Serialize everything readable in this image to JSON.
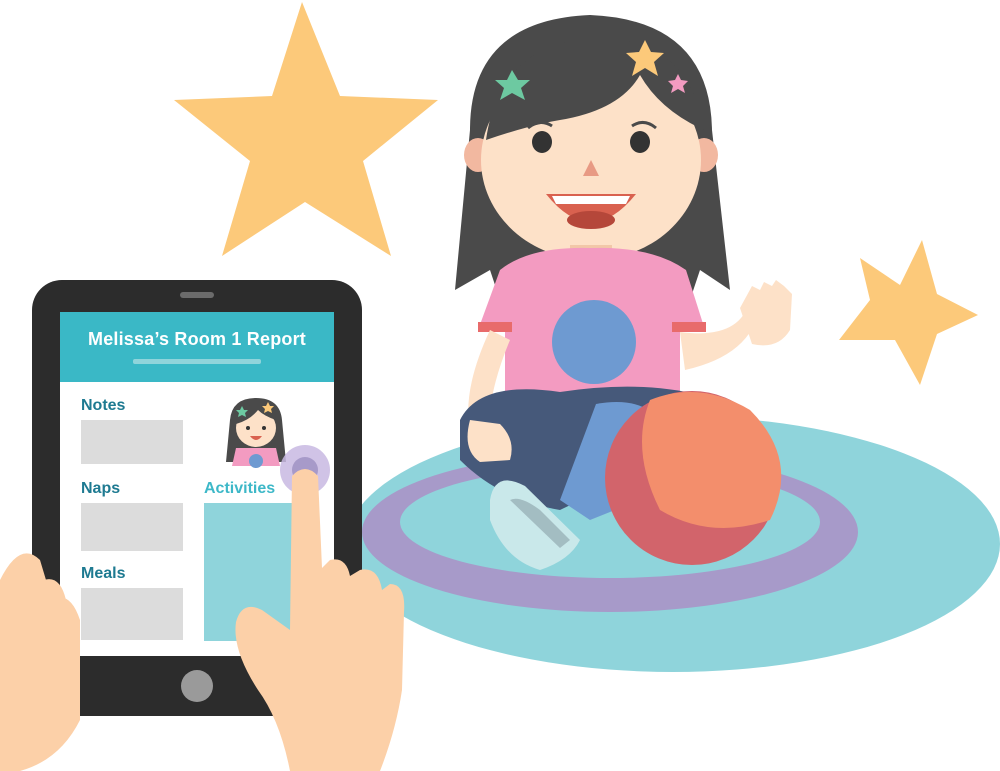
{
  "report": {
    "title": "Melissa’s Room 1 Report",
    "sections": {
      "notes": "Notes",
      "naps": "Naps",
      "meals": "Meals",
      "activities": "Activities"
    }
  },
  "colors": {
    "tablet_frame": "#2c2c2c",
    "header_teal": "#3ab8c6",
    "label_dark_teal": "#1e7a91",
    "label_light_teal": "#3db8c8",
    "placeholder_gray": "#dcdcdc",
    "activities_box": "#8fd4db",
    "rug_outer": "#8fd4db",
    "rug_purple": "#a79ac9",
    "star_yellow": "#fcc97a",
    "shirt_pink": "#f39bc1",
    "shirt_circle_blue": "#6e9ad1",
    "ball_orange": "#f38e6c",
    "ball_red": "#d2646b",
    "hair": "#4a4a4a",
    "skin": "#fde1c8"
  },
  "icons": {
    "star": "star-icon",
    "child_avatar": "child-avatar-icon",
    "home_button": "home-button-icon"
  }
}
